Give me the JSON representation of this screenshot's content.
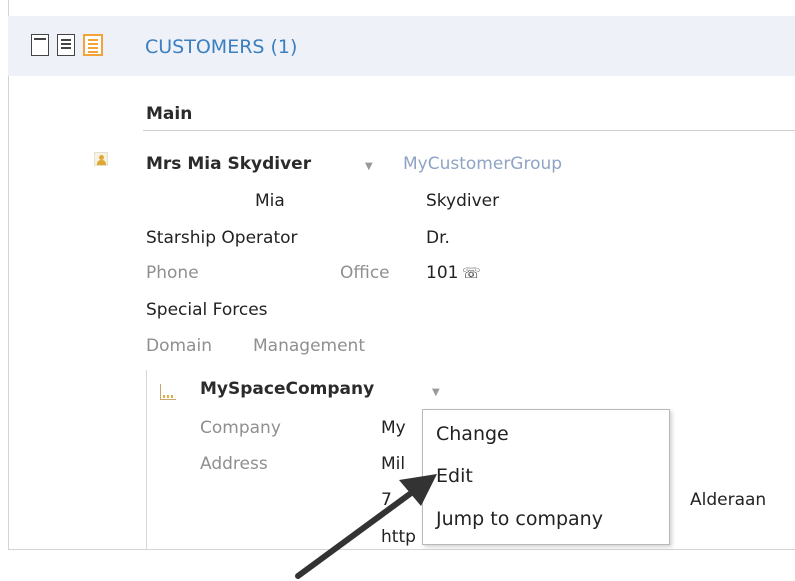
{
  "section": {
    "title": "CUSTOMERS (1)"
  },
  "view_buttons": [
    "list-view-icon",
    "compact-view-icon",
    "detail-view-icon"
  ],
  "tab": {
    "label": "Main"
  },
  "customer": {
    "name": "Mrs Mia Skydiver",
    "group": "MyCustomerGroup",
    "first_name": "Mia",
    "last_name": "Skydiver",
    "job_title": "Starship Operator",
    "title": "Dr.",
    "phone_label": "Phone",
    "phone_type": "Office",
    "phone_value": "101",
    "department": "Special Forces",
    "domain_label": "Domain",
    "domain_value": "Management"
  },
  "company": {
    "name": "MySpaceCompany",
    "company_label": "Company",
    "company_value": "My",
    "address_label": "Address",
    "address_line1": "Mil",
    "address_line2": "7",
    "address_city": "Alderaan",
    "url_partial": "http"
  },
  "context_menu": {
    "items": [
      "Change",
      "Edit",
      "Jump to company"
    ]
  },
  "colors": {
    "accent": "#3c7fbf",
    "header_bg": "#eef1f8",
    "active_view": "#f2a33a"
  }
}
